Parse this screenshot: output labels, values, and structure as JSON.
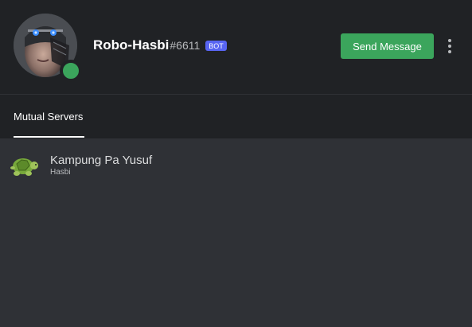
{
  "profile": {
    "username": "Robo-Hasbi",
    "discriminator": "#6611",
    "bot_tag": "BOT",
    "status": "online",
    "status_color": "#3ba55c"
  },
  "actions": {
    "send_message_label": "Send Message",
    "send_message_color": "#3ba55c",
    "more_icon": "more-vertical-icon"
  },
  "tabs": [
    {
      "label": "Mutual Servers",
      "active": true
    }
  ],
  "mutual_servers": [
    {
      "name": "Kampung Pa Yusuf",
      "nickname": "Hasbi",
      "icon": "turtle-icon"
    }
  ]
}
